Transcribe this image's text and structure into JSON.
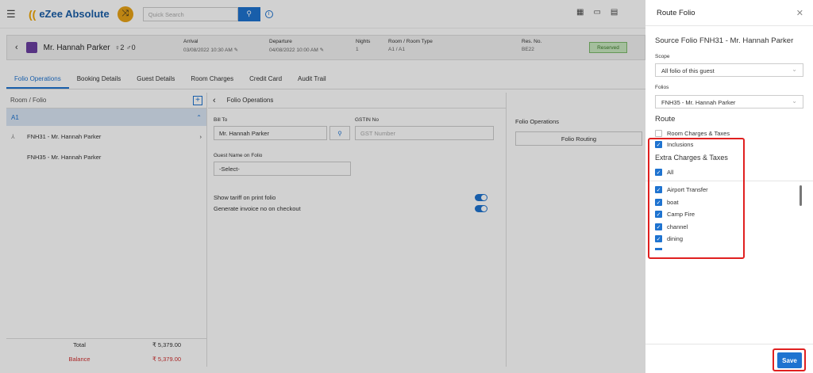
{
  "app": {
    "logo_text": "eZee Absolute",
    "search_placeholder": "Quick Search"
  },
  "guest": {
    "name": "Mr. Hannah Parker",
    "adults": "2",
    "children": "0",
    "arrival_label": "Arrival",
    "arrival": "03/08/2022 10:30 AM",
    "departure_label": "Departure",
    "departure": "04/08/2022 10:00 AM",
    "nights_label": "Nights",
    "nights": "1",
    "room_label": "Room / Room Type",
    "room": "A1 / A1",
    "resno_label": "Res. No.",
    "resno": "BE22",
    "status": "Reserved"
  },
  "tabs": [
    "Folio Operations",
    "Booking Details",
    "Guest Details",
    "Room Charges",
    "Credit Card",
    "Audit Trail"
  ],
  "left": {
    "header": "Room / Folio",
    "room": "A1",
    "folios": [
      "FNH31 - Mr. Hannah Parker",
      "FNH35 - Mr. Hannah Parker"
    ],
    "total_label": "Total",
    "total": "₹ 5,379.00",
    "balance_label": "Balance",
    "balance": "₹ 5,379.00"
  },
  "center": {
    "header": "Folio Operations",
    "bill_to_label": "Bill To",
    "bill_to": "Mr. Hannah Parker",
    "gstin_label": "GSTIN No",
    "gstin_placeholder": "GST Number",
    "guest_name_label": "Guest Name on Folio",
    "guest_name": "-Select-",
    "show_tariff": "Show tariff on print folio",
    "generate_invoice": "Generate invoice no on checkout"
  },
  "right": {
    "header": "Folio Operations",
    "routing_btn": "Folio Routing"
  },
  "sidebar": {
    "title": "Route Folio",
    "source": "Source Folio FNH31 - Mr. Hannah Parker",
    "scope_label": "Scope",
    "scope": "All folio of this guest",
    "folios_label": "Folios",
    "folios": "FNH35 - Mr. Hannah Parker",
    "route_h": "Route",
    "room_charges": "Room Charges & Taxes",
    "inclusions": "Inclusions",
    "extra_h": "Extra Charges & Taxes",
    "all": "All",
    "items": [
      "Airport Transfer",
      "boat",
      "Camp Fire",
      "channel",
      "dining"
    ],
    "save": "Save"
  }
}
